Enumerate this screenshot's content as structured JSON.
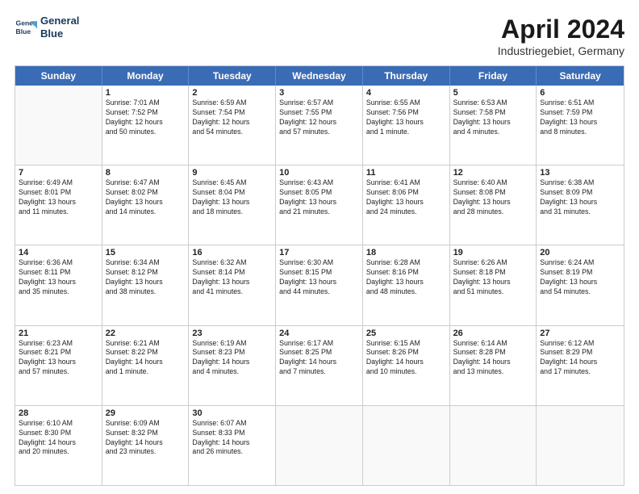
{
  "header": {
    "logo_line1": "General",
    "logo_line2": "Blue",
    "month": "April 2024",
    "location": "Industriegebiet, Germany"
  },
  "days": [
    "Sunday",
    "Monday",
    "Tuesday",
    "Wednesday",
    "Thursday",
    "Friday",
    "Saturday"
  ],
  "rows": [
    [
      {
        "day": "",
        "info": ""
      },
      {
        "day": "1",
        "info": "Sunrise: 7:01 AM\nSunset: 7:52 PM\nDaylight: 12 hours\nand 50 minutes."
      },
      {
        "day": "2",
        "info": "Sunrise: 6:59 AM\nSunset: 7:54 PM\nDaylight: 12 hours\nand 54 minutes."
      },
      {
        "day": "3",
        "info": "Sunrise: 6:57 AM\nSunset: 7:55 PM\nDaylight: 12 hours\nand 57 minutes."
      },
      {
        "day": "4",
        "info": "Sunrise: 6:55 AM\nSunset: 7:56 PM\nDaylight: 13 hours\nand 1 minute."
      },
      {
        "day": "5",
        "info": "Sunrise: 6:53 AM\nSunset: 7:58 PM\nDaylight: 13 hours\nand 4 minutes."
      },
      {
        "day": "6",
        "info": "Sunrise: 6:51 AM\nSunset: 7:59 PM\nDaylight: 13 hours\nand 8 minutes."
      }
    ],
    [
      {
        "day": "7",
        "info": "Sunrise: 6:49 AM\nSunset: 8:01 PM\nDaylight: 13 hours\nand 11 minutes."
      },
      {
        "day": "8",
        "info": "Sunrise: 6:47 AM\nSunset: 8:02 PM\nDaylight: 13 hours\nand 14 minutes."
      },
      {
        "day": "9",
        "info": "Sunrise: 6:45 AM\nSunset: 8:04 PM\nDaylight: 13 hours\nand 18 minutes."
      },
      {
        "day": "10",
        "info": "Sunrise: 6:43 AM\nSunset: 8:05 PM\nDaylight: 13 hours\nand 21 minutes."
      },
      {
        "day": "11",
        "info": "Sunrise: 6:41 AM\nSunset: 8:06 PM\nDaylight: 13 hours\nand 24 minutes."
      },
      {
        "day": "12",
        "info": "Sunrise: 6:40 AM\nSunset: 8:08 PM\nDaylight: 13 hours\nand 28 minutes."
      },
      {
        "day": "13",
        "info": "Sunrise: 6:38 AM\nSunset: 8:09 PM\nDaylight: 13 hours\nand 31 minutes."
      }
    ],
    [
      {
        "day": "14",
        "info": "Sunrise: 6:36 AM\nSunset: 8:11 PM\nDaylight: 13 hours\nand 35 minutes."
      },
      {
        "day": "15",
        "info": "Sunrise: 6:34 AM\nSunset: 8:12 PM\nDaylight: 13 hours\nand 38 minutes."
      },
      {
        "day": "16",
        "info": "Sunrise: 6:32 AM\nSunset: 8:14 PM\nDaylight: 13 hours\nand 41 minutes."
      },
      {
        "day": "17",
        "info": "Sunrise: 6:30 AM\nSunset: 8:15 PM\nDaylight: 13 hours\nand 44 minutes."
      },
      {
        "day": "18",
        "info": "Sunrise: 6:28 AM\nSunset: 8:16 PM\nDaylight: 13 hours\nand 48 minutes."
      },
      {
        "day": "19",
        "info": "Sunrise: 6:26 AM\nSunset: 8:18 PM\nDaylight: 13 hours\nand 51 minutes."
      },
      {
        "day": "20",
        "info": "Sunrise: 6:24 AM\nSunset: 8:19 PM\nDaylight: 13 hours\nand 54 minutes."
      }
    ],
    [
      {
        "day": "21",
        "info": "Sunrise: 6:23 AM\nSunset: 8:21 PM\nDaylight: 13 hours\nand 57 minutes."
      },
      {
        "day": "22",
        "info": "Sunrise: 6:21 AM\nSunset: 8:22 PM\nDaylight: 14 hours\nand 1 minute."
      },
      {
        "day": "23",
        "info": "Sunrise: 6:19 AM\nSunset: 8:23 PM\nDaylight: 14 hours\nand 4 minutes."
      },
      {
        "day": "24",
        "info": "Sunrise: 6:17 AM\nSunset: 8:25 PM\nDaylight: 14 hours\nand 7 minutes."
      },
      {
        "day": "25",
        "info": "Sunrise: 6:15 AM\nSunset: 8:26 PM\nDaylight: 14 hours\nand 10 minutes."
      },
      {
        "day": "26",
        "info": "Sunrise: 6:14 AM\nSunset: 8:28 PM\nDaylight: 14 hours\nand 13 minutes."
      },
      {
        "day": "27",
        "info": "Sunrise: 6:12 AM\nSunset: 8:29 PM\nDaylight: 14 hours\nand 17 minutes."
      }
    ],
    [
      {
        "day": "28",
        "info": "Sunrise: 6:10 AM\nSunset: 8:30 PM\nDaylight: 14 hours\nand 20 minutes."
      },
      {
        "day": "29",
        "info": "Sunrise: 6:09 AM\nSunset: 8:32 PM\nDaylight: 14 hours\nand 23 minutes."
      },
      {
        "day": "30",
        "info": "Sunrise: 6:07 AM\nSunset: 8:33 PM\nDaylight: 14 hours\nand 26 minutes."
      },
      {
        "day": "",
        "info": ""
      },
      {
        "day": "",
        "info": ""
      },
      {
        "day": "",
        "info": ""
      },
      {
        "day": "",
        "info": ""
      }
    ]
  ]
}
